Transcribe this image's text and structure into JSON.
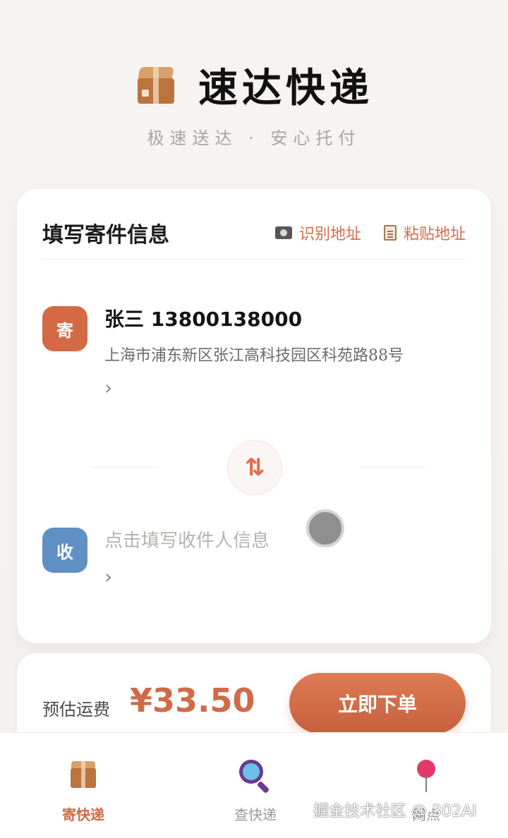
{
  "header": {
    "title": "速达快递",
    "subtitle": "极速送达 · 安心托付",
    "logo_icon": "package-box-icon"
  },
  "form_card": {
    "title": "填写寄件信息",
    "actions": [
      {
        "label": "识别地址",
        "icon": "camera-icon"
      },
      {
        "label": "粘贴地址",
        "icon": "clipboard-icon"
      }
    ],
    "sender": {
      "badge": "寄",
      "name_phone": "张三 13800138000",
      "address": "上海市浦东新区张江高科技园区科苑路88号",
      "chevron": "›"
    },
    "swap_icon": "⇅",
    "receiver": {
      "badge": "收",
      "placeholder": "点击填写收件人信息",
      "chevron": "›"
    }
  },
  "price_bar": {
    "label": "预估运费",
    "value": "¥33.50",
    "order_button": "立即下单"
  },
  "bottom_nav": {
    "items": [
      {
        "label": "寄快递",
        "icon": "package-box-icon",
        "active": true
      },
      {
        "label": "查快递",
        "icon": "magnifier-icon",
        "active": false
      },
      {
        "label": "网点",
        "icon": "location-pin-icon",
        "active": false
      }
    ]
  },
  "watermark": "掘金技术社区 @ 302AI",
  "colors": {
    "accent": "#d46a45",
    "receiver_badge": "#5f8fc3",
    "background": "#f6f3f0"
  }
}
